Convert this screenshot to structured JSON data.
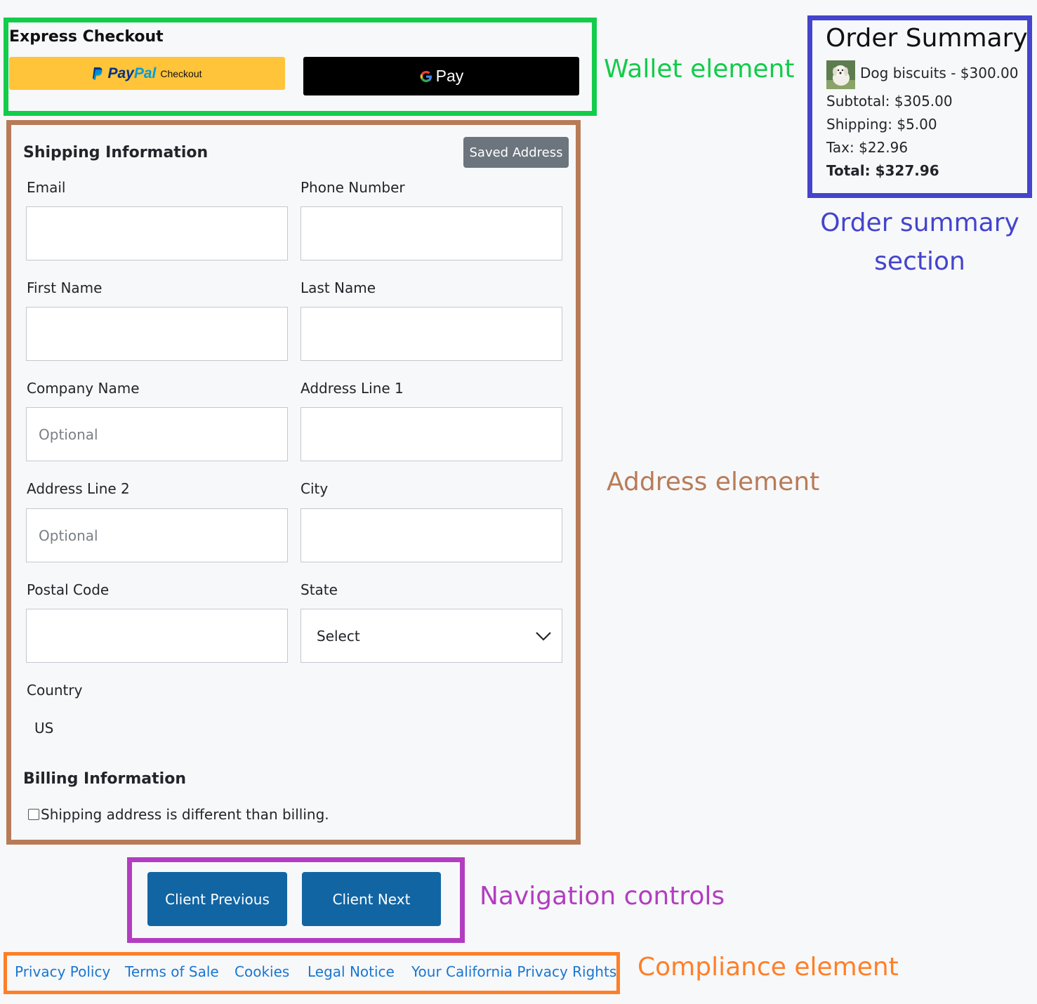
{
  "annotations": {
    "wallet": "Wallet element",
    "order_summary": "Order summary section",
    "address": "Address element",
    "navigation": "Navigation controls",
    "compliance": "Compliance element"
  },
  "wallet": {
    "title": "Express Checkout",
    "paypal_brand_pay": "Pay",
    "paypal_brand_pal": "Pal",
    "paypal_checkout": "Checkout",
    "gpay_label": "Pay"
  },
  "shipping": {
    "title": "Shipping Information",
    "saved_address_button": "Saved Address",
    "fields": {
      "email": {
        "label": "Email",
        "value": "",
        "placeholder": ""
      },
      "phone": {
        "label": "Phone Number",
        "value": "",
        "placeholder": ""
      },
      "first_name": {
        "label": "First Name",
        "value": "",
        "placeholder": ""
      },
      "last_name": {
        "label": "Last Name",
        "value": "",
        "placeholder": ""
      },
      "company": {
        "label": "Company Name",
        "value": "",
        "placeholder": "Optional"
      },
      "address1": {
        "label": "Address Line 1",
        "value": "",
        "placeholder": ""
      },
      "address2": {
        "label": "Address Line 2",
        "value": "",
        "placeholder": "Optional"
      },
      "city": {
        "label": "City",
        "value": "",
        "placeholder": ""
      },
      "postal_code": {
        "label": "Postal Code",
        "value": "",
        "placeholder": ""
      },
      "state": {
        "label": "State",
        "selected": "Select"
      }
    },
    "country": {
      "label": "Country",
      "value": "US"
    }
  },
  "billing": {
    "title": "Billing Information",
    "checkbox_label": "Shipping address is different than billing.",
    "checked": false
  },
  "order_summary": {
    "title": "Order Summary",
    "item": "Dog biscuits - $300.00",
    "subtotal": "Subtotal: $305.00",
    "shipping": "Shipping: $5.00",
    "tax": "Tax: $22.96",
    "total": "Total: $327.96"
  },
  "navigation": {
    "previous": "Client Previous",
    "next": "Client Next"
  },
  "compliance": {
    "links": [
      "Privacy Policy",
      "Terms of Sale",
      "Cookies",
      "Legal Notice",
      "Your California Privacy Rights"
    ]
  },
  "colors": {
    "wallet_frame": "#13cc4a",
    "address_frame": "#b87b57",
    "summary_frame": "#4444cc",
    "nav_frame": "#b23dc0",
    "compliance_frame": "#ff7f27",
    "primary_button": "#1265a3",
    "secondary_button": "#6c757d",
    "paypal_yellow": "#ffc439",
    "link": "#1976d2"
  }
}
